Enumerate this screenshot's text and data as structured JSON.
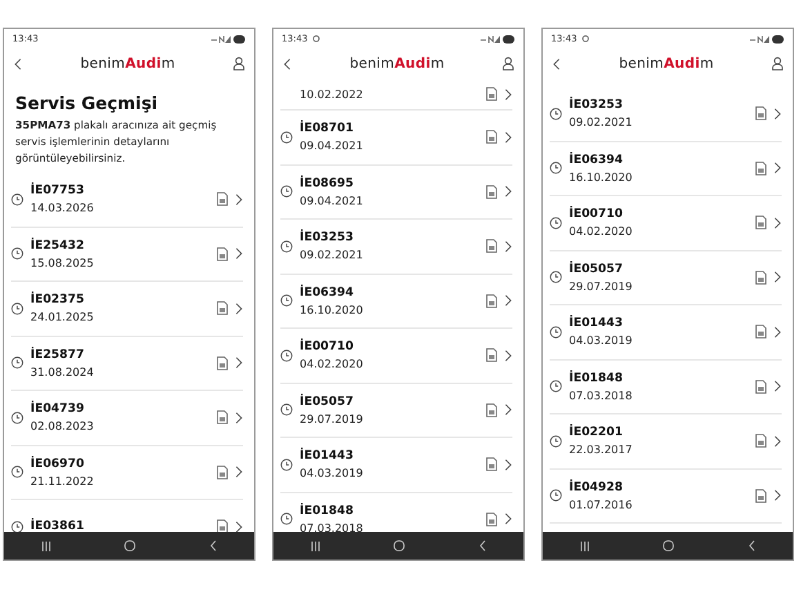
{
  "phones": [
    {
      "status": {
        "time": "13:43",
        "extra_icon": false
      },
      "header": {
        "brand": {
          "pre": "benim",
          "accent": "Audi",
          "post": "m"
        }
      },
      "page_title": "Servis Geçmişi",
      "description": "**35PMA73** plakalı aracınıza ait geçmiş servis işlemlerinin detaylarını görüntüleyebilirsiniz.",
      "rows": [
        {
          "code": "İE07753",
          "date": "14.03.2026"
        },
        {
          "code": "İE25432",
          "date": "15.08.2025"
        },
        {
          "code": "İE02375",
          "date": "24.01.2025"
        },
        {
          "code": "İE25877",
          "date": "31.08.2024"
        },
        {
          "code": "İE04739",
          "date": "02.08.2023"
        },
        {
          "code": "İE06970",
          "date": "21.11.2022"
        },
        {
          "code": "İE03861"
        }
      ]
    },
    {
      "status": {
        "time": "13:43",
        "extra_icon": true
      },
      "header": {
        "brand": {
          "pre": "benim",
          "accent": "Audi",
          "post": "m"
        }
      },
      "rows": [
        {
          "date": "10.02.2022"
        },
        {
          "code": "İE08701",
          "date": "09.04.2021"
        },
        {
          "code": "İE08695",
          "date": "09.04.2021"
        },
        {
          "code": "İE03253",
          "date": "09.02.2021"
        },
        {
          "code": "İE06394",
          "date": "16.10.2020"
        },
        {
          "code": "İE00710",
          "date": "04.02.2020"
        },
        {
          "code": "İE05057",
          "date": "29.07.2019"
        },
        {
          "code": "İE01443",
          "date": "04.03.2019"
        },
        {
          "code": "İE01848",
          "date": "07.03.2018"
        }
      ]
    },
    {
      "status": {
        "time": "13:43",
        "extra_icon": true
      },
      "header": {
        "brand": {
          "pre": "benim",
          "accent": "Audi",
          "post": "m"
        }
      },
      "rows": [
        {
          "code": "İE03253",
          "date": "09.02.2021"
        },
        {
          "code": "İE06394",
          "date": "16.10.2020"
        },
        {
          "code": "İE00710",
          "date": "04.02.2020"
        },
        {
          "code": "İE05057",
          "date": "29.07.2019"
        },
        {
          "code": "İE01443",
          "date": "04.03.2019"
        },
        {
          "code": "İE01848",
          "date": "07.03.2018"
        },
        {
          "code": "İE02201",
          "date": "22.03.2017"
        },
        {
          "code": "İE04928",
          "date": "01.07.2016"
        }
      ]
    }
  ]
}
